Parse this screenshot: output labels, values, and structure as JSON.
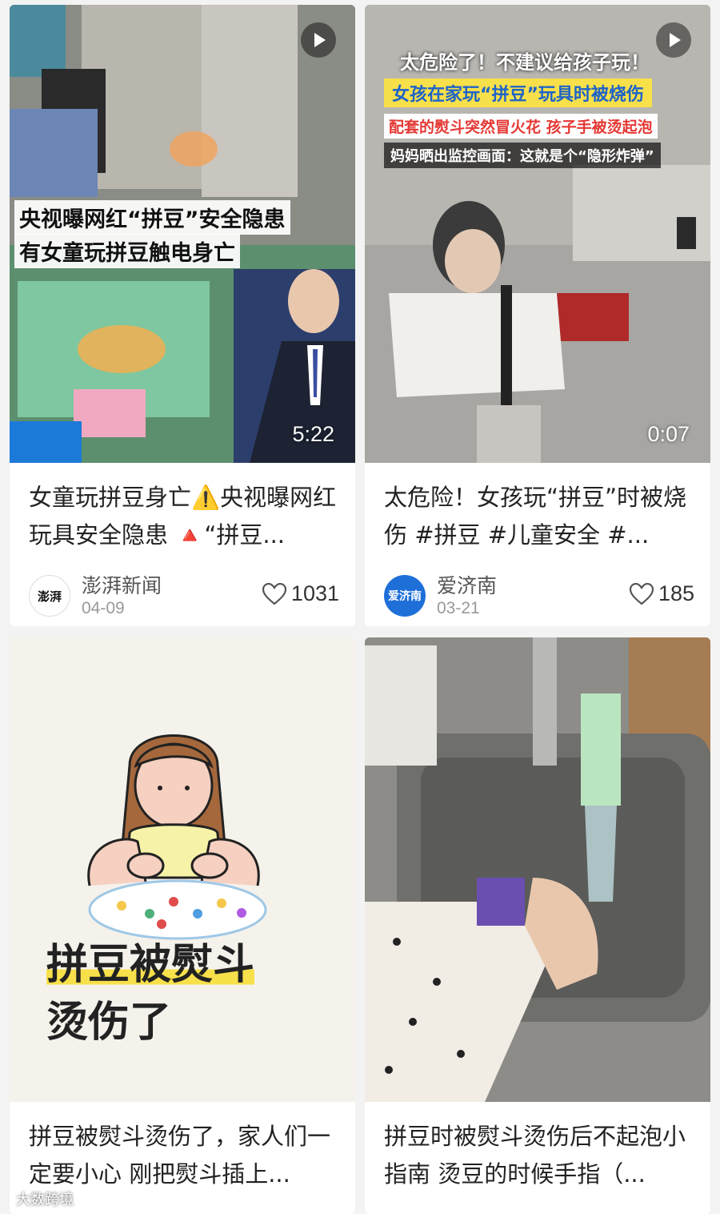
{
  "cards": [
    {
      "overlay_line1": "央视曝网红“拼豆”安全隐患",
      "overlay_line2": "有女童玩拼豆触电身亡",
      "duration": "5:22",
      "title": "女童玩拼豆身亡⚠️央视曝网红玩具安全隐患 🔺“拼豆...",
      "author": "澎湃新闻",
      "avatar_text": "澎湃",
      "date": "04-09",
      "likes": "1031"
    },
    {
      "overlay_line1": "太危险了！不建议给孩子玩！",
      "overlay_line2": "女孩在家玩“拼豆”玩具时被烧伤",
      "overlay_line3": "配套的熨斗突然冒火花 孩子手被烫起泡",
      "overlay_line4": "妈妈晒出监控画面：这就是个“隐形炸弹”",
      "duration": "0:07",
      "title": "太危险！女孩玩“拼豆”时被烧伤 #拼豆 #儿童安全 #...",
      "author": "爱济南",
      "avatar_text": "爱济南",
      "date": "03-21",
      "likes": "185"
    },
    {
      "headline_line1": "拼豆被熨斗",
      "headline_line2": "烫伤了",
      "title": "拼豆被熨斗烫伤了，家人们一定要小心 刚把熨斗插上..."
    },
    {
      "title": "拼豆时被熨斗烫伤后不起泡小指南 烫豆的时候手指（..."
    }
  ],
  "watermark": "大数跨境",
  "colors": {
    "accent_red": "#e53935",
    "overlay_yellow": "#f7e04a",
    "overlay_blue": "#1e63c8"
  }
}
